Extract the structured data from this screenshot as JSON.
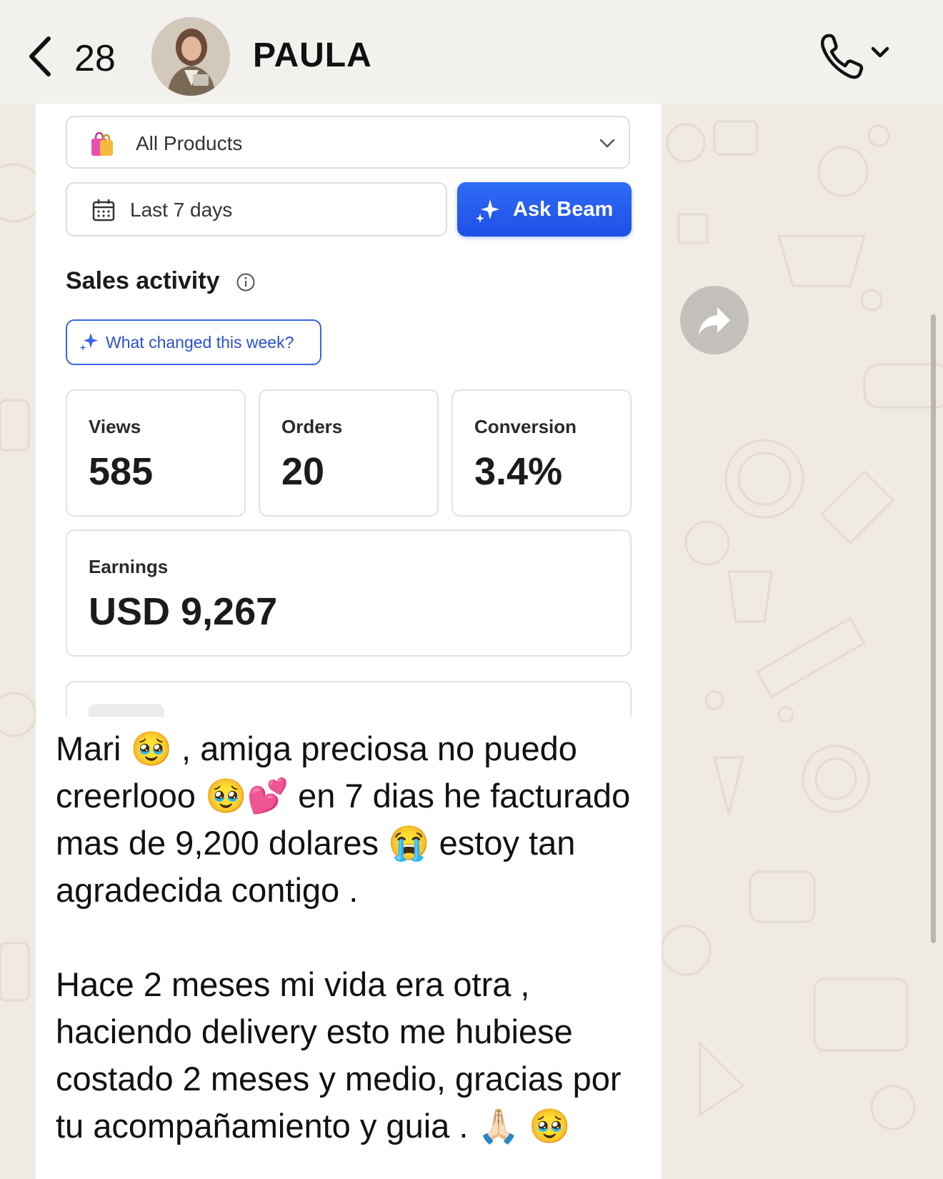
{
  "header": {
    "back_count": "28",
    "contact_name": "PAULA"
  },
  "shared_screenshot": {
    "product_filter": "All Products",
    "date_range": "Last 7 days",
    "ask_button": "Ask Beam",
    "section_title": "Sales activity",
    "changed_button": "What changed this week?",
    "stats": [
      {
        "label": "Views",
        "value": "585"
      },
      {
        "label": "Orders",
        "value": "20"
      },
      {
        "label": "Conversion",
        "value": "3.4%"
      }
    ],
    "earnings": {
      "label": "Earnings",
      "value": "USD 9,267"
    },
    "accent_color": "#2f6cf6"
  },
  "message": {
    "paragraphs": [
      "Mari 🥹 , amiga preciosa no puedo creerlooo 🥹💕 en 7 dias he facturado mas de 9,200 dolares 😭 estoy tan agradecida contigo .",
      "Hace 2 meses mi vida era otra , haciendo delivery esto me hubiese costado 2 meses y medio, gracias por tu acompañamiento y guia . 🙏🏻 🥹"
    ]
  },
  "icons": {
    "back": "chevron-left-icon",
    "call": "phone-icon",
    "forward": "forward-arrow-icon",
    "info": "info-icon",
    "calendar": "calendar-icon",
    "sparkle": "sparkle-icon",
    "bag": "shopping-bag-icon"
  }
}
